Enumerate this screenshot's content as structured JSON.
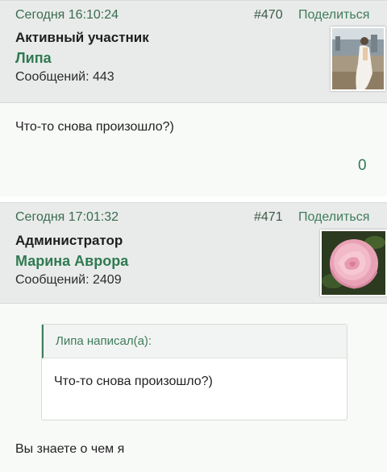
{
  "posts": [
    {
      "date": "Сегодня 16:10:24",
      "number": "#470",
      "share_label": "Поделиться",
      "role": "Активный участник",
      "author": "Липа",
      "message_count": "Сообщений: 443",
      "avatar": "bride-photo-avatar",
      "body": "Что-то снова произошло?)",
      "reactions": "0"
    },
    {
      "date": "Сегодня 17:01:32",
      "number": "#471",
      "share_label": "Поделиться",
      "role": "Администратор",
      "author": "Марина Аврора",
      "message_count": "Сообщений: 2409",
      "avatar": "pink-rose-avatar",
      "quote": {
        "author": "Липа написал(а):",
        "text": "Что-то снова произошло?)"
      },
      "body": "Вы знаете о чем я"
    }
  ],
  "colors": {
    "accent": "#3f7c5b",
    "author_name": "#2f7a52",
    "header_bg": "#e9ebea"
  }
}
